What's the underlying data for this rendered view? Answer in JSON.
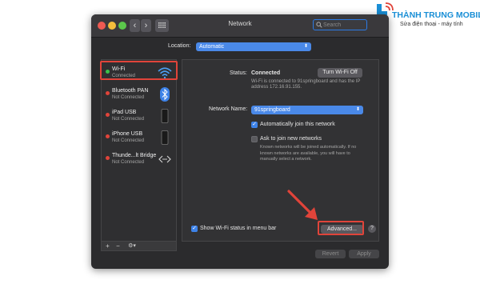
{
  "window": {
    "title": "Network"
  },
  "search": {
    "placeholder": "Search"
  },
  "location": {
    "label": "Location:",
    "value": "Automatic"
  },
  "services": [
    {
      "name": "Wi-Fi",
      "status": "Connected",
      "dot": "#3ac24a",
      "icon": "wifi-icon"
    },
    {
      "name": "Bluetooth PAN",
      "status": "Not Connected",
      "dot": "#e0443a",
      "icon": "bluetooth-icon"
    },
    {
      "name": "iPad USB",
      "status": "Not Connected",
      "dot": "#e0443a",
      "icon": "phone-icon"
    },
    {
      "name": "iPhone USB",
      "status": "Not Connected",
      "dot": "#e0443a",
      "icon": "phone-icon"
    },
    {
      "name": "Thunde...lt Bridge",
      "status": "Not Connected",
      "dot": "#e0443a",
      "icon": "bridge-icon"
    }
  ],
  "sidebar_controls": {
    "add": "+",
    "remove": "−",
    "action": "⚙▾"
  },
  "status": {
    "label": "Status:",
    "value": "Connected",
    "description": "Wi-Fi is connected to 91springboard and has the IP address 172.16.91.155.",
    "turn_off_label": "Turn Wi-Fi Off"
  },
  "network_name": {
    "label": "Network Name:",
    "value": "91springboard"
  },
  "options": {
    "auto_join": {
      "label": "Automatically join this network",
      "checked": true
    },
    "ask_join": {
      "label": "Ask to join new networks",
      "checked": false
    },
    "ask_join_note": "Known networks will be joined automatically. If no known networks are available, you will have to manually select a network."
  },
  "menu_bar": {
    "label": "Show Wi-Fi status in menu bar",
    "checked": true
  },
  "buttons": {
    "advanced": "Advanced...",
    "help": "?",
    "revert": "Revert",
    "apply": "Apply"
  },
  "brand": {
    "name": "THÀNH TRUNG MOBILE",
    "tagline": "Sửa điện thoại - máy tính",
    "color": "#1a8fd6"
  },
  "colors": {
    "highlight": "#e0443a",
    "accent": "#4a89e8"
  }
}
